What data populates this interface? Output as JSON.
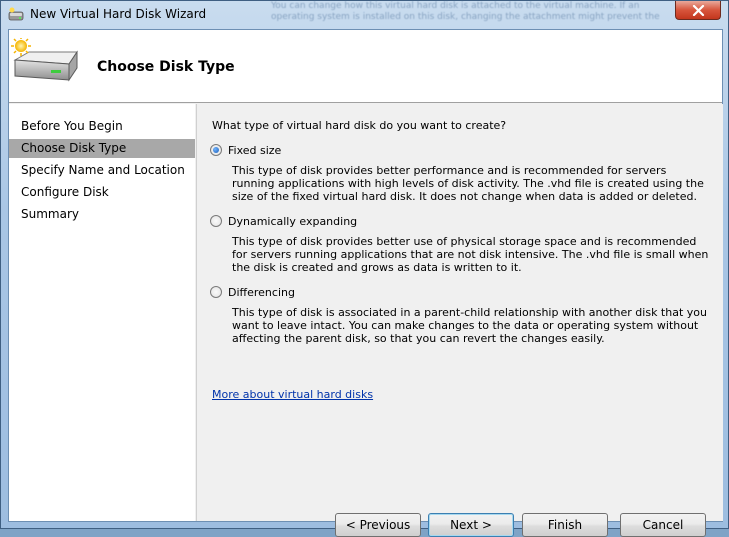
{
  "window": {
    "title": "New Virtual Hard Disk Wizard",
    "background_text": "You can change how this virtual hard disk is attached to the virtual machine. If an operating system is installed on this disk, changing the attachment might prevent the"
  },
  "header": {
    "title": "Choose Disk Type"
  },
  "nav": {
    "items": [
      {
        "label": "Before You Begin",
        "selected": false
      },
      {
        "label": "Choose Disk Type",
        "selected": true
      },
      {
        "label": "Specify Name and Location",
        "selected": false
      },
      {
        "label": "Configure Disk",
        "selected": false
      },
      {
        "label": "Summary",
        "selected": false
      }
    ]
  },
  "content": {
    "question": "What type of virtual hard disk do you want to create?",
    "options": [
      {
        "label": "Fixed size",
        "checked": true,
        "description": "This type of disk provides better performance and is recommended for servers running applications with high levels of disk activity. The .vhd file is created using the size of the fixed virtual hard disk. It does not change when data is added or deleted."
      },
      {
        "label": "Dynamically expanding",
        "checked": false,
        "description": "This type of disk provides better use of physical storage space and is recommended for servers running applications that are not disk intensive. The .vhd file is small when the disk is created and grows as data is written to it."
      },
      {
        "label": "Differencing",
        "checked": false,
        "description": "This type of disk is associated in a parent-child relationship with another disk that you want to leave intact. You can make changes to the data or operating system without affecting the parent disk, so that you can revert the changes easily."
      }
    ],
    "link": "More about virtual hard disks"
  },
  "buttons": {
    "previous": "< Previous",
    "next": "Next >",
    "finish": "Finish",
    "cancel": "Cancel"
  },
  "colors": {
    "selected_nav": "#a8a8a8",
    "link": "#0033aa",
    "close_button": "#c3361d"
  },
  "icons": {
    "title": "disk-wizard-icon",
    "header": "hard-disk-icon",
    "close": "close-icon"
  }
}
